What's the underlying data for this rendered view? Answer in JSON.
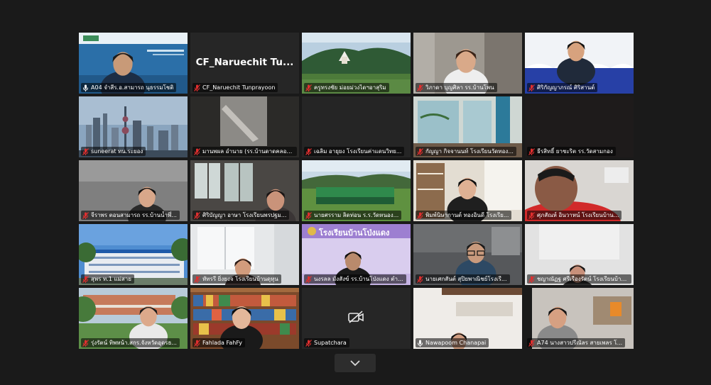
{
  "meeting": {
    "scroll_down_icon": "chevron-down-icon",
    "active_speaker_color": "#c7f24a",
    "muted_mic_color": "#e02f2f"
  },
  "participants": [
    {
      "name": "A04 จำสีร.อ.สามารถ นุธรรมโชติ",
      "muted": false,
      "video": "speaker-slide"
    },
    {
      "name": "CF_Naruechit Tunprayoon",
      "display_title": "CF_Naruechit Tu...",
      "muted": true,
      "video": "off-name"
    },
    {
      "name": "ครูทรงชัย ม่อยม่วงไดฯอาสุริม",
      "muted": true,
      "video": "temple-hill"
    },
    {
      "name": "วิภาดา บุญศิลา รร.บ้านโพน",
      "muted": true,
      "video": "person-room"
    },
    {
      "name": "ศิริกัญญาภรณ์ ศิริสานต์",
      "muted": true,
      "video": "speaker-stage"
    },
    {
      "name": "suneerat ทน.ระยอง",
      "muted": true,
      "video": "city-skyline"
    },
    {
      "name": "มานพผล อำนาย (รร.บ้านดาดคลอง...",
      "muted": true,
      "video": "dark-blur"
    },
    {
      "name": "เฉลิม อายุยง โรงเรียนค่าแดนวิทย...",
      "muted": true,
      "video": "dark"
    },
    {
      "name": "กัญญา กิจจานนท์ โรงเรียนวัดทอง...",
      "muted": true,
      "video": "window-room"
    },
    {
      "name": "ธีรสิทธิ์ ยาชะริต รร.วัดสามกอง",
      "muted": true,
      "video": "dark-red"
    },
    {
      "name": "จีราพร ตอนสามารถ รร.บ้านน้ำพึ่...",
      "muted": true,
      "video": "person-dark"
    },
    {
      "name": "ศิริบัญญา อาษา โรงเรียนพรปฐม...",
      "muted": true,
      "video": "person-window"
    },
    {
      "name": "นายศรราม ลิดท่อน ร.ร.วัดหนอง...",
      "muted": true,
      "video": "field-group"
    },
    {
      "name": "พิมพ์นิษากานต์ ทองอินดี โรงเรีย...",
      "muted": true,
      "video": "person-shelf"
    },
    {
      "name": "ศุภสัณห์ อินวาหน์ โรงเรียนบ้าน...",
      "muted": true,
      "video": "person-red"
    },
    {
      "name": "สุพร ท.1 แม่สาย",
      "muted": true,
      "video": "school-building"
    },
    {
      "name": "หัทรรี ยิ่งยงจ โรงเรียนบ้านดุหุน",
      "muted": true,
      "video": "person-curtain"
    },
    {
      "name": "นงรลล มังสังข์ รร.บ้านโป่งแดง ตำ...",
      "muted": true,
      "video": "school-banner",
      "banner_text": "โรงเรียนบ้านโป่งแดง"
    },
    {
      "name": "นายเศกสันต์ สุปิยพาณิชย์โรงเรี...",
      "muted": true,
      "video": "man-glasses"
    },
    {
      "name": "ชญาณัฏฐ ศรีเรืองรัตน์ โรงเรียนบ้าน...",
      "muted": true,
      "video": "person-light"
    },
    {
      "name": "รุ่งรัตน์ ทิพหน้า.สกร.จังหวัดอุดรธ...",
      "muted": true,
      "video": "woman-outdoor"
    },
    {
      "name": "Fahlada FahFy",
      "muted": true,
      "video": "woman-bookshelf"
    },
    {
      "name": "Supatchara",
      "muted": true,
      "video": "off-cam"
    },
    {
      "name": "Nawapoom Chanapai",
      "muted": false,
      "video": "person-ceiling"
    },
    {
      "name": "A74 นางสาวปรีณัลร สายเพลร โ...",
      "muted": true,
      "video": "woman-desk"
    }
  ]
}
